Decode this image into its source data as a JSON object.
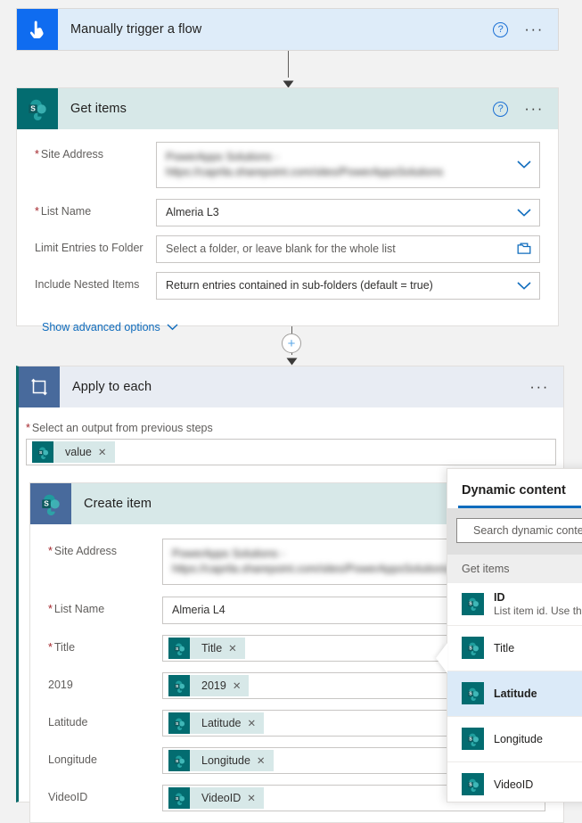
{
  "trigger": {
    "title": "Manually trigger a flow",
    "icon": "manual-trigger-hand-icon",
    "help_label": "?",
    "menu_label": "···"
  },
  "get_items": {
    "title": "Get items",
    "icon": "sharepoint-icon",
    "help_label": "?",
    "menu_label": "···",
    "fields": [
      {
        "label": "Site Address",
        "required": true,
        "value": "PowerApps Solutions - https://caprila.sharepoint.com/sites/PowerAppsSolutions",
        "blurred": true,
        "control": "dropdown"
      },
      {
        "label": "List Name",
        "required": true,
        "value": "Almeria L3",
        "blurred": false,
        "control": "dropdown"
      },
      {
        "label": "Limit Entries to Folder",
        "required": false,
        "placeholder": "Select a folder, or leave blank for the whole list",
        "control": "folder-picker"
      },
      {
        "label": "Include Nested Items",
        "required": false,
        "value": "Return entries contained in sub-folders (default = true)",
        "blurred": false,
        "control": "dropdown"
      }
    ],
    "advanced_options_label": "Show advanced options"
  },
  "apply_to_each": {
    "title": "Apply to each",
    "icon": "loop-icon",
    "menu_label": "···",
    "output_label": "Select an output from previous steps",
    "output_required": true,
    "token": {
      "label": "value",
      "remove_label": "✕",
      "icon": "sharepoint-icon"
    }
  },
  "create_item": {
    "title": "Create item",
    "icon": "sharepoint-icon",
    "fields": [
      {
        "label": "Site Address",
        "required": true,
        "value": "PowerApps Solutions - https://caprila.sharepoint.com/sites/PowerAppsSolutions",
        "blurred": true,
        "type": "text"
      },
      {
        "label": "List Name",
        "required": true,
        "value": "Almeria L4",
        "blurred": false,
        "type": "text"
      },
      {
        "label": "Title",
        "required": true,
        "type": "token",
        "token": "Title"
      },
      {
        "label": "2019",
        "required": false,
        "type": "token",
        "token": "2019"
      },
      {
        "label": "Latitude",
        "required": false,
        "type": "token",
        "token": "Latitude"
      },
      {
        "label": "Longitude",
        "required": false,
        "type": "token",
        "token": "Longitude"
      },
      {
        "label": "VideoID",
        "required": false,
        "type": "token",
        "token": "VideoID"
      }
    ],
    "token_remove_label": "✕"
  },
  "dynamic_content": {
    "title": "Dynamic content",
    "search_placeholder": "Search dynamic content",
    "search_value": "",
    "search_icon": "search-icon",
    "group_label": "Get items",
    "items": [
      {
        "name": "ID",
        "description": "List item id. Use this",
        "selected": false,
        "icon": "sharepoint-icon"
      },
      {
        "name": "Title",
        "description": "",
        "selected": false,
        "icon": "sharepoint-icon"
      },
      {
        "name": "Latitude",
        "description": "",
        "selected": true,
        "icon": "sharepoint-icon"
      },
      {
        "name": "Longitude",
        "description": "",
        "selected": false,
        "icon": "sharepoint-icon"
      },
      {
        "name": "VideoID",
        "description": "",
        "selected": false,
        "icon": "sharepoint-icon"
      }
    ]
  },
  "colors": {
    "trigger_header": "#deecf9",
    "trigger_icon_bg": "#0f6cf0",
    "sharepoint_teal": "#036c70",
    "sharepoint_header": "#d7e8e8",
    "loop_icon_bg": "#486a9c",
    "loop_header": "#e8ecf3",
    "accent_blue": "#0f6cbd",
    "required_red": "#a4262c",
    "selected_row": "#dbeaf8",
    "canvas_bg": "#f2f2f2"
  }
}
